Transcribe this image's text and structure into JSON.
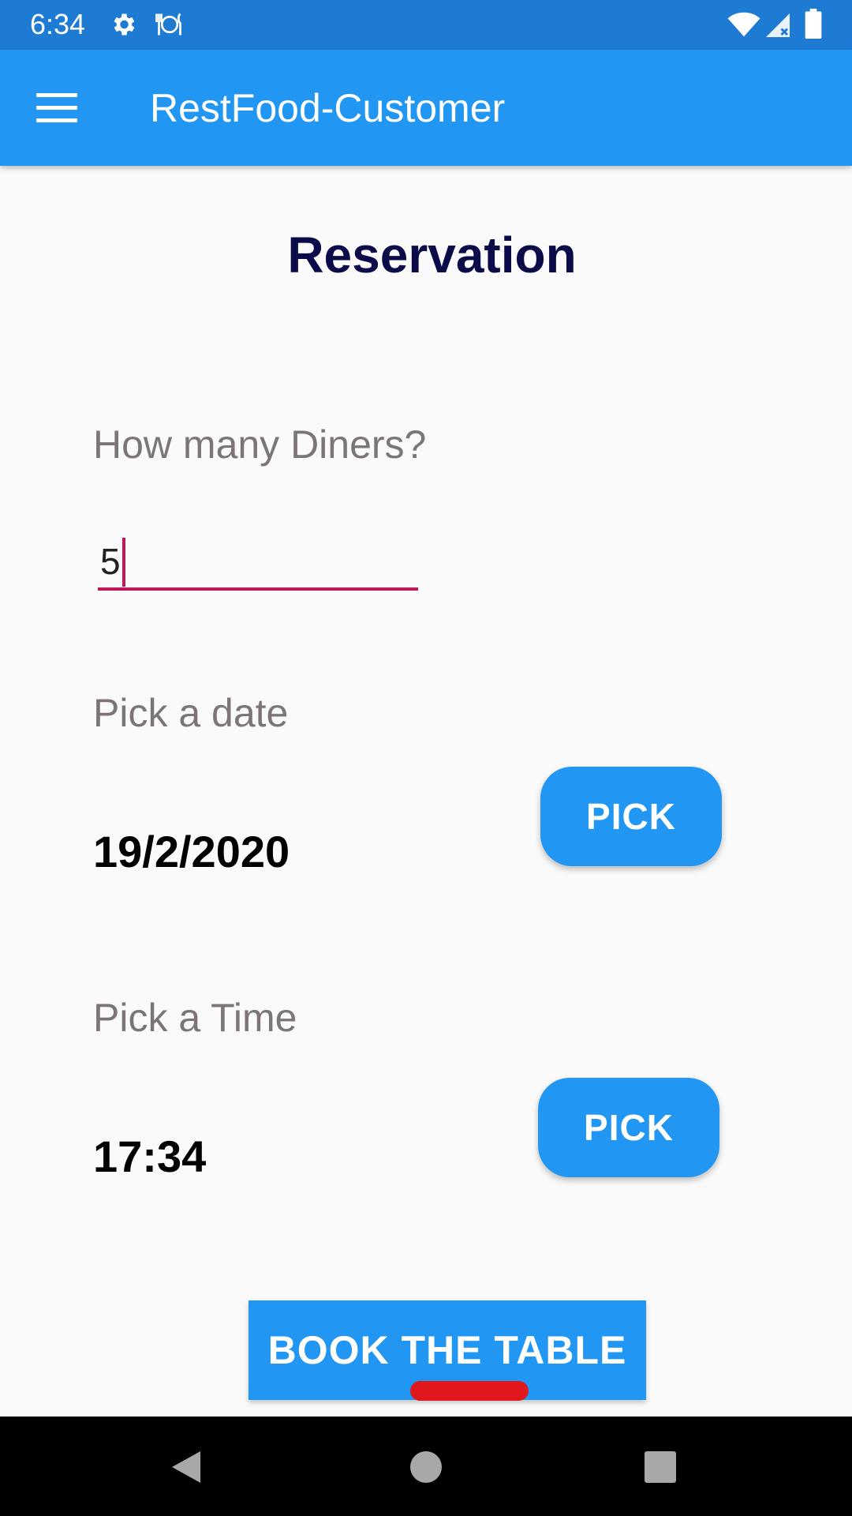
{
  "status_bar": {
    "time": "6:34",
    "icons": [
      "gear-icon",
      "food-icon",
      "wifi-icon",
      "signal-icon",
      "battery-icon"
    ]
  },
  "app_bar": {
    "title": "RestFood-Customer",
    "menu_icon": "hamburger-menu-icon",
    "color": "#2196f3"
  },
  "reservation": {
    "title": "Reservation",
    "diners_label": "How many Diners?",
    "diners_value": "5",
    "date_label": "Pick a date",
    "date_value": "19/2/2020",
    "date_button": "PICK",
    "time_label": "Pick a Time",
    "time_value": "17:34",
    "time_button": "PICK",
    "book_button": "BOOK THE TABLE"
  },
  "nav_bar": {
    "icons": [
      "back-icon",
      "home-icon",
      "recent-apps-icon"
    ]
  },
  "colors": {
    "status_bar": "#1e7bd3",
    "accent": "#2196f3",
    "input_underline": "#c2185b",
    "title_text": "#0b0b4a"
  }
}
